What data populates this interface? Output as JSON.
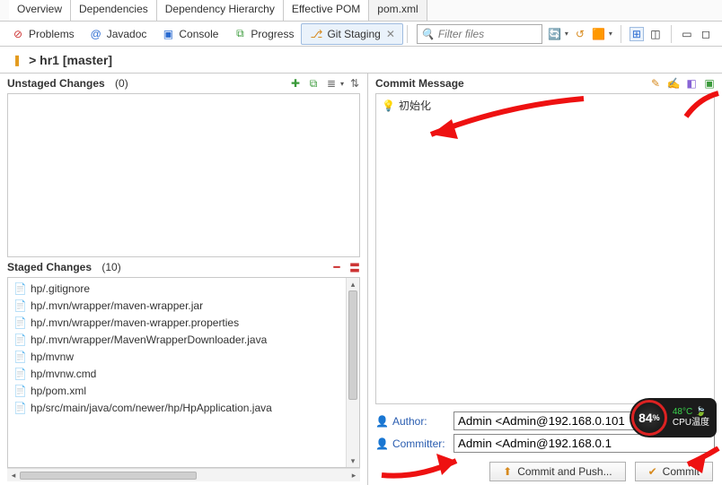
{
  "editorTabs": [
    "Overview",
    "Dependencies",
    "Dependency Hierarchy",
    "Effective POM",
    "pom.xml"
  ],
  "activeEditorTab": 4,
  "viewTabs": {
    "problems": "Problems",
    "javadoc": "Javadoc",
    "console": "Console",
    "progress": "Progress",
    "gitstaging": "Git Staging"
  },
  "activeView": "gitstaging",
  "filterPlaceholder": "Filter files",
  "repo": {
    "prefix": "> ",
    "name": "hr1",
    "branch": "[master]"
  },
  "unstaged": {
    "title": "Unstaged Changes",
    "count": "(0)",
    "items": []
  },
  "staged": {
    "title": "Staged Changes",
    "count": "(10)",
    "items": [
      "hp/.gitignore",
      "hp/.mvn/wrapper/maven-wrapper.jar",
      "hp/.mvn/wrapper/maven-wrapper.properties",
      "hp/.mvn/wrapper/MavenWrapperDownloader.java",
      "hp/mvnw",
      "hp/mvnw.cmd",
      "hp/pom.xml",
      "hp/src/main/java/com/newer/hp/HpApplication.java"
    ]
  },
  "commit": {
    "heading": "Commit Message",
    "message": "初始化",
    "authorLabel": "Author:",
    "committerLabel": "Committer:",
    "author": "Admin <Admin@192.168.0.101",
    "committer": "Admin <Admin@192.168.0.1",
    "commitPushBtn": "Commit and Push...",
    "commitBtn": "Commit"
  },
  "cpu": {
    "pct": "84",
    "pctSym": "%",
    "temp": "48°C",
    "label": "CPU温度"
  }
}
